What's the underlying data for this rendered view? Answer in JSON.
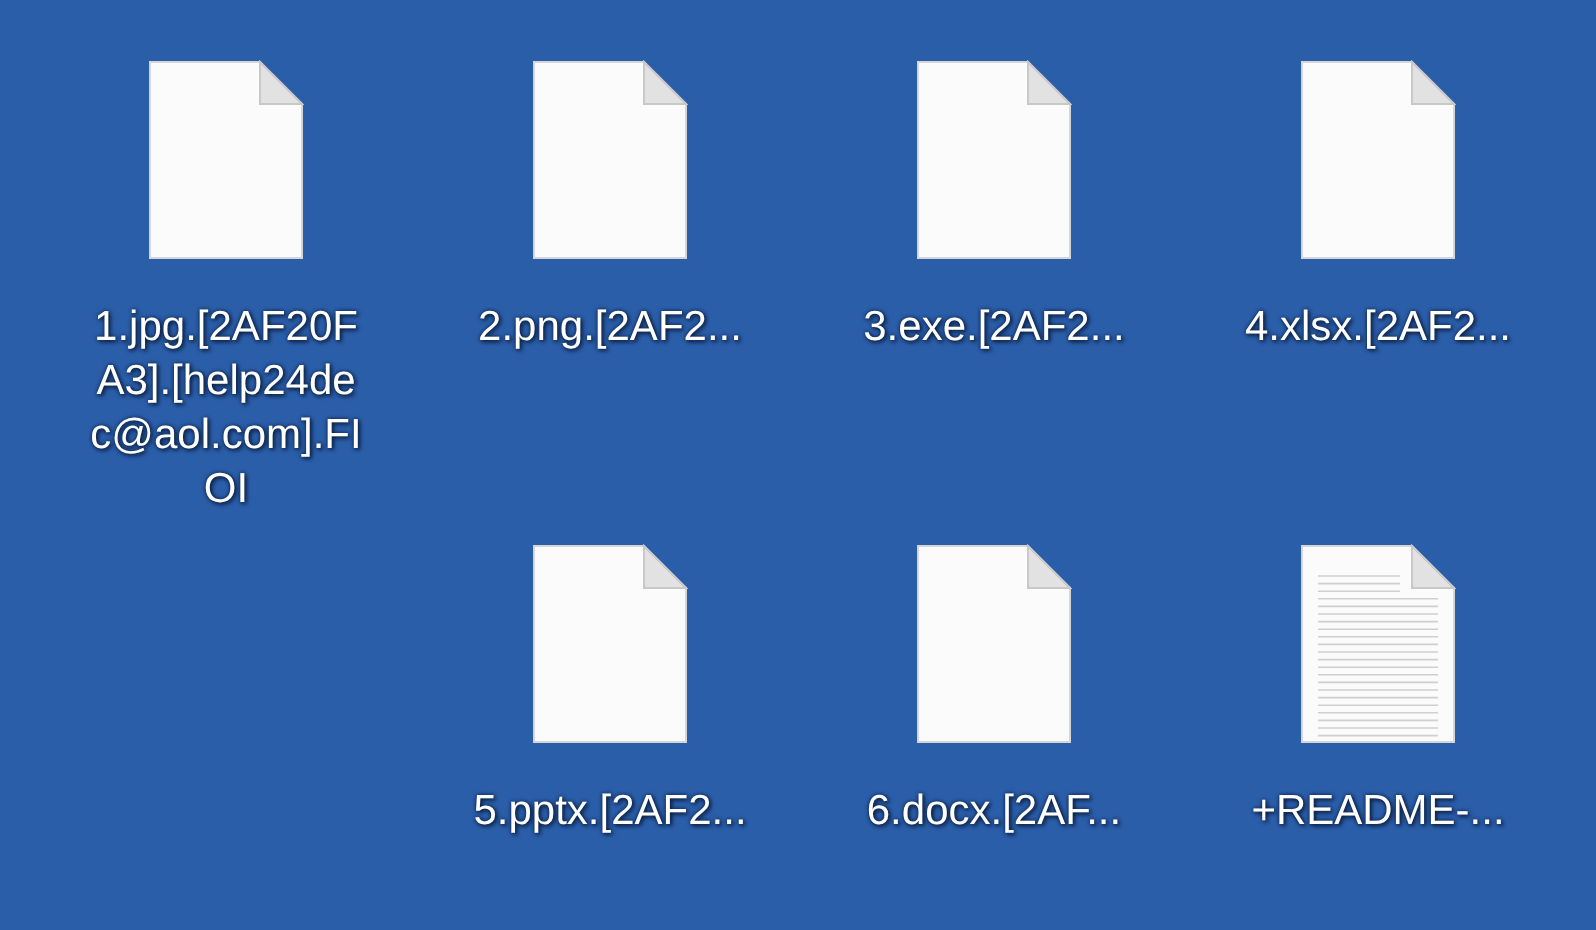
{
  "files": [
    {
      "kind": "blank",
      "label_lines": [
        "1.jpg.[2AF20F",
        "A3].[help24de",
        "c@aol.com].FI",
        "OI"
      ]
    },
    {
      "kind": "blank",
      "label_lines": [
        "2.png.[2AF2..."
      ]
    },
    {
      "kind": "blank",
      "label_lines": [
        "3.exe.[2AF2..."
      ]
    },
    {
      "kind": "blank",
      "label_lines": [
        "4.xlsx.[2AF2..."
      ]
    },
    {
      "kind": "blank",
      "label_lines": [
        "5.pptx.[2AF2..."
      ]
    },
    {
      "kind": "blank",
      "label_lines": [
        "6.docx.[2AF..."
      ]
    },
    {
      "kind": "text",
      "label_lines": [
        "+README-..."
      ]
    }
  ]
}
